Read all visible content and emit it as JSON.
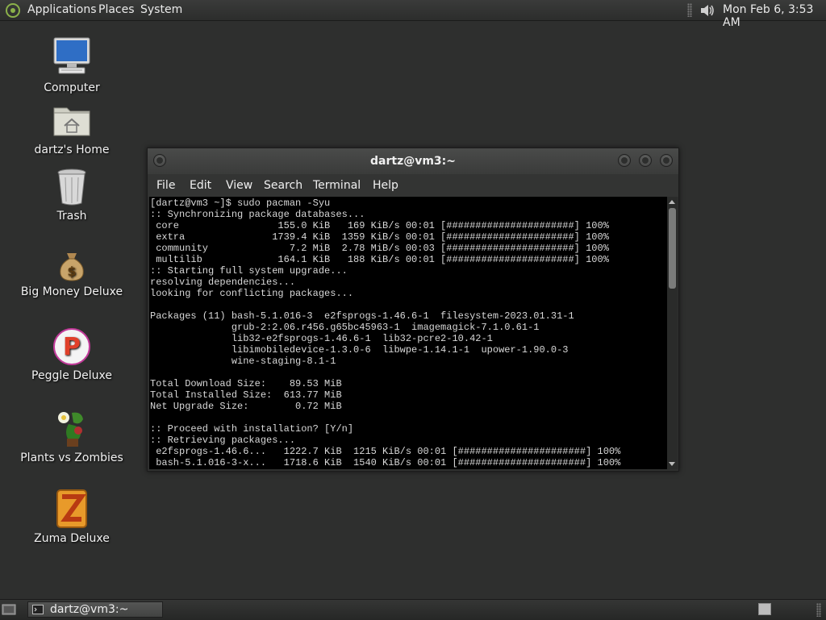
{
  "top_panel": {
    "menus": [
      "Applications",
      "Places",
      "System"
    ],
    "clock": "Mon Feb  6,  3:53 AM"
  },
  "desktop_icons": [
    {
      "label": "Computer",
      "icon": "computer-icon"
    },
    {
      "label": "dartz's Home",
      "icon": "home-folder-icon"
    },
    {
      "label": "Trash",
      "icon": "trash-icon"
    },
    {
      "label": "Big Money Deluxe",
      "icon": "money-bag-icon"
    },
    {
      "label": "Peggle Deluxe",
      "icon": "peggle-icon"
    },
    {
      "label": "Plants vs Zombies",
      "icon": "plants-vs-zombies-icon"
    },
    {
      "label": "Zuma Deluxe",
      "icon": "zuma-icon"
    }
  ],
  "terminal": {
    "title": "dartz@vm3:~",
    "menu": [
      "File",
      "Edit",
      "View",
      "Search",
      "Terminal",
      "Help"
    ],
    "lines": [
      "[dartz@vm3 ~]$ sudo pacman -Syu",
      ":: Synchronizing package databases...",
      " core                 155.0 KiB   169 KiB/s 00:01 [######################] 100%",
      " extra               1739.4 KiB  1359 KiB/s 00:01 [######################] 100%",
      " community              7.2 MiB  2.78 MiB/s 00:03 [######################] 100%",
      " multilib             164.1 KiB   188 KiB/s 00:01 [######################] 100%",
      ":: Starting full system upgrade...",
      "resolving dependencies...",
      "looking for conflicting packages...",
      "",
      "Packages (11) bash-5.1.016-3  e2fsprogs-1.46.6-1  filesystem-2023.01.31-1",
      "              grub-2:2.06.r456.g65bc45963-1  imagemagick-7.1.0.61-1",
      "              lib32-e2fsprogs-1.46.6-1  lib32-pcre2-10.42-1",
      "              libimobiledevice-1.3.0-6  libwpe-1.14.1-1  upower-1.90.0-3",
      "              wine-staging-8.1-1",
      "",
      "Total Download Size:    89.53 MiB",
      "Total Installed Size:  613.77 MiB",
      "Net Upgrade Size:        0.72 MiB",
      "",
      ":: Proceed with installation? [Y/n]",
      ":: Retrieving packages...",
      " e2fsprogs-1.46.6...   1222.7 KiB  1215 KiB/s 00:01 [######################] 100%",
      " bash-5.1.016-3-x...   1718.6 KiB  1540 KiB/s 00:01 [######################] 100%"
    ]
  },
  "taskbar": {
    "window_label": "dartz@vm3:~"
  }
}
